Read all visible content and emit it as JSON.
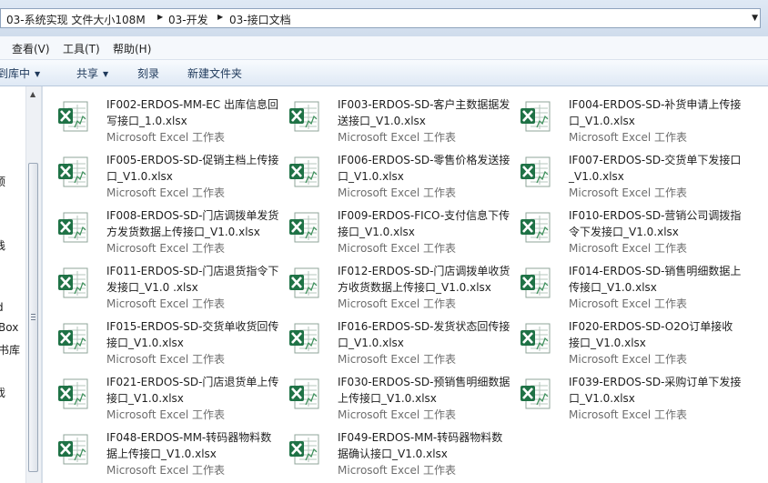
{
  "address_bar": {
    "crumbs": [
      "03-系统实现 文件大小108M",
      "03-开发",
      "03-接口文档"
    ]
  },
  "menu": [
    "查看(V)",
    "工具(T)",
    "帮助(H)"
  ],
  "commands": [
    {
      "label": "到库中",
      "dropdown": true
    },
    {
      "label": "共享",
      "dropdown": true
    },
    {
      "label": "刻录",
      "dropdown": false
    },
    {
      "label": "新建文件夹",
      "dropdown": false
    }
  ],
  "nav_fragments": [
    "顶",
    "栈",
    "d",
    "Box",
    "书库",
    "戏"
  ],
  "file_type_label": "Microsoft Excel 工作表",
  "colors": {
    "excel_green": "#1f7246",
    "accent": "#1e395b"
  },
  "files": [
    {
      "name": "IF002-ERDOS-MM-EC 出库信息回写接口_1.0.xlsx",
      "type": "Microsoft Excel 工作表"
    },
    {
      "name": "IF003-ERDOS-SD-客户主数据据发送接口_V1.0.xlsx",
      "type": "Microsoft Excel 工作表"
    },
    {
      "name": "IF004-ERDOS-SD-补货申请上传接口_V1.0.xlsx",
      "type": "Microsoft Excel 工作表"
    },
    {
      "name": "IF005-ERDOS-SD-促销主档上传接口_V1.0.xlsx",
      "type": "Microsoft Excel 工作表"
    },
    {
      "name": "IF006-ERDOS-SD-零售价格发送接口_V1.0.xlsx",
      "type": "Microsoft Excel 工作表"
    },
    {
      "name": "IF007-ERDOS-SD-交货单下发接口_V1.0.xlsx",
      "type": "Microsoft Excel 工作表"
    },
    {
      "name": "IF008-ERDOS-SD-门店调拨单发货方发货数据上传接口_V1.0.xlsx",
      "type": "Microsoft Excel 工作表"
    },
    {
      "name": "IF009-ERDOS-FICO-支付信息下传接口_V1.0.xlsx",
      "type": "Microsoft Excel 工作表"
    },
    {
      "name": "IF010-ERDOS-SD-营销公司调拨指令下发接口_V1.0.xlsx",
      "type": "Microsoft Excel 工作表"
    },
    {
      "name": "IF011-ERDOS-SD-门店退货指令下发接口_V1.0 .xlsx",
      "type": "Microsoft Excel 工作表"
    },
    {
      "name": "IF012-ERDOS-SD-门店调拨单收货方收货数据上传接口_V1.0.xlsx",
      "type": "Microsoft Excel 工作表"
    },
    {
      "name": "IF014-ERDOS-SD-销售明细数据上传接口_V1.0.xlsx",
      "type": "Microsoft Excel 工作表"
    },
    {
      "name": "IF015-ERDOS-SD-交货单收货回传接口_V1.0.xlsx",
      "type": "Microsoft Excel 工作表"
    },
    {
      "name": "IF016-ERDOS-SD-发货状态回传接口_V1.0.xlsx",
      "type": "Microsoft Excel 工作表"
    },
    {
      "name": "IF020-ERDOS-SD-O2O订单接收接口_V1.0.xlsx",
      "type": "Microsoft Excel 工作表"
    },
    {
      "name": "IF021-ERDOS-SD-门店退货单上传接口_V1.0.xlsx",
      "type": "Microsoft Excel 工作表"
    },
    {
      "name": "IF030-ERDOS-SD-预销售明细数据上传接口_V1.0.xlsx",
      "type": "Microsoft Excel 工作表"
    },
    {
      "name": "IF039-ERDOS-SD-采购订单下发接口_V1.0.xlsx",
      "type": "Microsoft Excel 工作表"
    },
    {
      "name": "IF048-ERDOS-MM-转码器物料数据上传接口_V1.0.xlsx",
      "type": "Microsoft Excel 工作表"
    },
    {
      "name": "IF049-ERDOS-MM-转码器物料数据确认接口_V1.0.xlsx",
      "type": "Microsoft Excel 工作表"
    }
  ]
}
